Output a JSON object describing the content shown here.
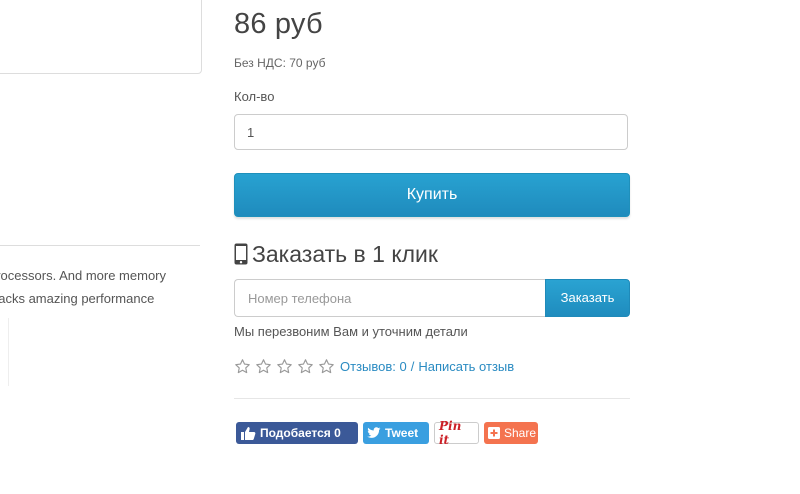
{
  "left_panel": {
    "line1": "processors. And more memory",
    "line2": "packs amazing performance"
  },
  "product": {
    "price": "86 руб",
    "tax_note": "Без НДС: 70 руб",
    "qty_label": "Кол-во",
    "qty_value": "1",
    "buy_label": "Купить"
  },
  "one_click": {
    "title": "Заказать в 1 клик",
    "phone_placeholder": "Номер телефона",
    "order_label": "Заказать",
    "note": "Мы перезвоним Вам и уточним детали"
  },
  "rating": {
    "stars_filled": 0,
    "stars_total": 5,
    "reviews_link": "Отзывов: 0",
    "separator": "/",
    "write_review": "Написать отзыв"
  },
  "share": {
    "facebook": "Подобается 0",
    "twitter": "Tweet",
    "pinterest": "Pin it",
    "share": "Share"
  },
  "colors": {
    "accent": "#2196c9",
    "link": "#2a8bc2",
    "facebook": "#3b5998",
    "twitter": "#3a9fe0",
    "share": "#f4734f"
  },
  "icons": {
    "phone": "mobile-phone-icon",
    "star": "star-outline-icon",
    "facebook": "thumbs-up-icon",
    "twitter": "twitter-bird-icon",
    "share": "plus-box-icon"
  }
}
